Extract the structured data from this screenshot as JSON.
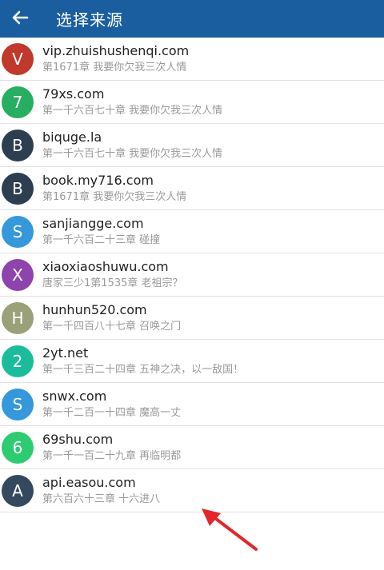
{
  "header": {
    "title": "选择来源",
    "back_icon": "arrow-left-icon",
    "color": "#1b5ea0"
  },
  "sources": [
    {
      "letter": "V",
      "name": "vip.zhuishushenqi.com",
      "chapter": "第1671章 我要你欠我三次人情",
      "color": "#c0392b"
    },
    {
      "letter": "7",
      "name": "79xs.com",
      "chapter": "第一千六百七十章 我要你欠我三次人情",
      "color": "#27ae60"
    },
    {
      "letter": "B",
      "name": "biquge.la",
      "chapter": "第一千六百七十章 我要你欠我三次人情",
      "color": "#2c3e50"
    },
    {
      "letter": "B",
      "name": "book.my716.com",
      "chapter": "第1671章 我要你欠我三次人情",
      "color": "#2c3e50"
    },
    {
      "letter": "S",
      "name": "sanjiangge.com",
      "chapter": "第一千六百二十三章 碰撞",
      "color": "#3498db"
    },
    {
      "letter": "X",
      "name": "xiaoxiaoshuwu.com",
      "chapter": "唐家三少1第1535章 老祖宗？",
      "color": "#8e44ad"
    },
    {
      "letter": "H",
      "name": "hunhun520.com",
      "chapter": "第一千四百八十七章 召唤之门",
      "color": "#9aa078"
    },
    {
      "letter": "2",
      "name": "2yt.net",
      "chapter": "第一千三百二十四章 五神之决，以一敌国！",
      "color": "#1abc9c"
    },
    {
      "letter": "S",
      "name": "snwx.com",
      "chapter": "第一千二百一十四章 魔高一丈",
      "color": "#3498db"
    },
    {
      "letter": "6",
      "name": "69shu.com",
      "chapter": "第一千一百二十九章 再临明都",
      "color": "#2ecc71"
    },
    {
      "letter": "A",
      "name": "api.easou.com",
      "chapter": "第六百六十三章 十六进八",
      "color": "#34495e"
    }
  ],
  "annotation": {
    "icon": "red-arrow-icon",
    "color": "#e3262a"
  }
}
